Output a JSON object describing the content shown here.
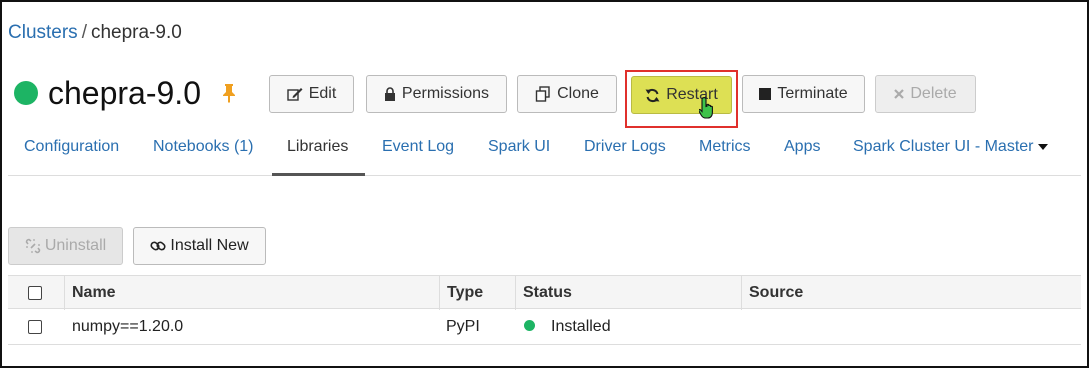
{
  "breadcrumb": {
    "root": "Clusters",
    "separator": "/",
    "current": "chepra-9.0"
  },
  "cluster": {
    "name": "chepra-9.0",
    "status_color": "#1db464",
    "pinned": true
  },
  "actions": {
    "edit": "Edit",
    "permissions": "Permissions",
    "clone": "Clone",
    "restart": "Restart",
    "terminate": "Terminate",
    "delete": "Delete"
  },
  "tabs": [
    {
      "label": "Configuration",
      "active": false
    },
    {
      "label": "Notebooks (1)",
      "active": false
    },
    {
      "label": "Libraries",
      "active": true
    },
    {
      "label": "Event Log",
      "active": false
    },
    {
      "label": "Spark UI",
      "active": false
    },
    {
      "label": "Driver Logs",
      "active": false
    },
    {
      "label": "Metrics",
      "active": false
    },
    {
      "label": "Apps",
      "active": false
    },
    {
      "label": "Spark Cluster UI - Master",
      "active": false,
      "dropdown": true
    }
  ],
  "libraries": {
    "uninstall_label": "Uninstall",
    "install_label": "Install New",
    "columns": [
      "Name",
      "Type",
      "Status",
      "Source"
    ],
    "rows": [
      {
        "name": "numpy==1.20.0",
        "type": "PyPI",
        "status": "Installed",
        "status_color": "#1db464",
        "source": ""
      }
    ]
  },
  "colors": {
    "link": "#2a6fb0",
    "highlight_button": "#dde054",
    "highlight_border": "#e0302c"
  }
}
